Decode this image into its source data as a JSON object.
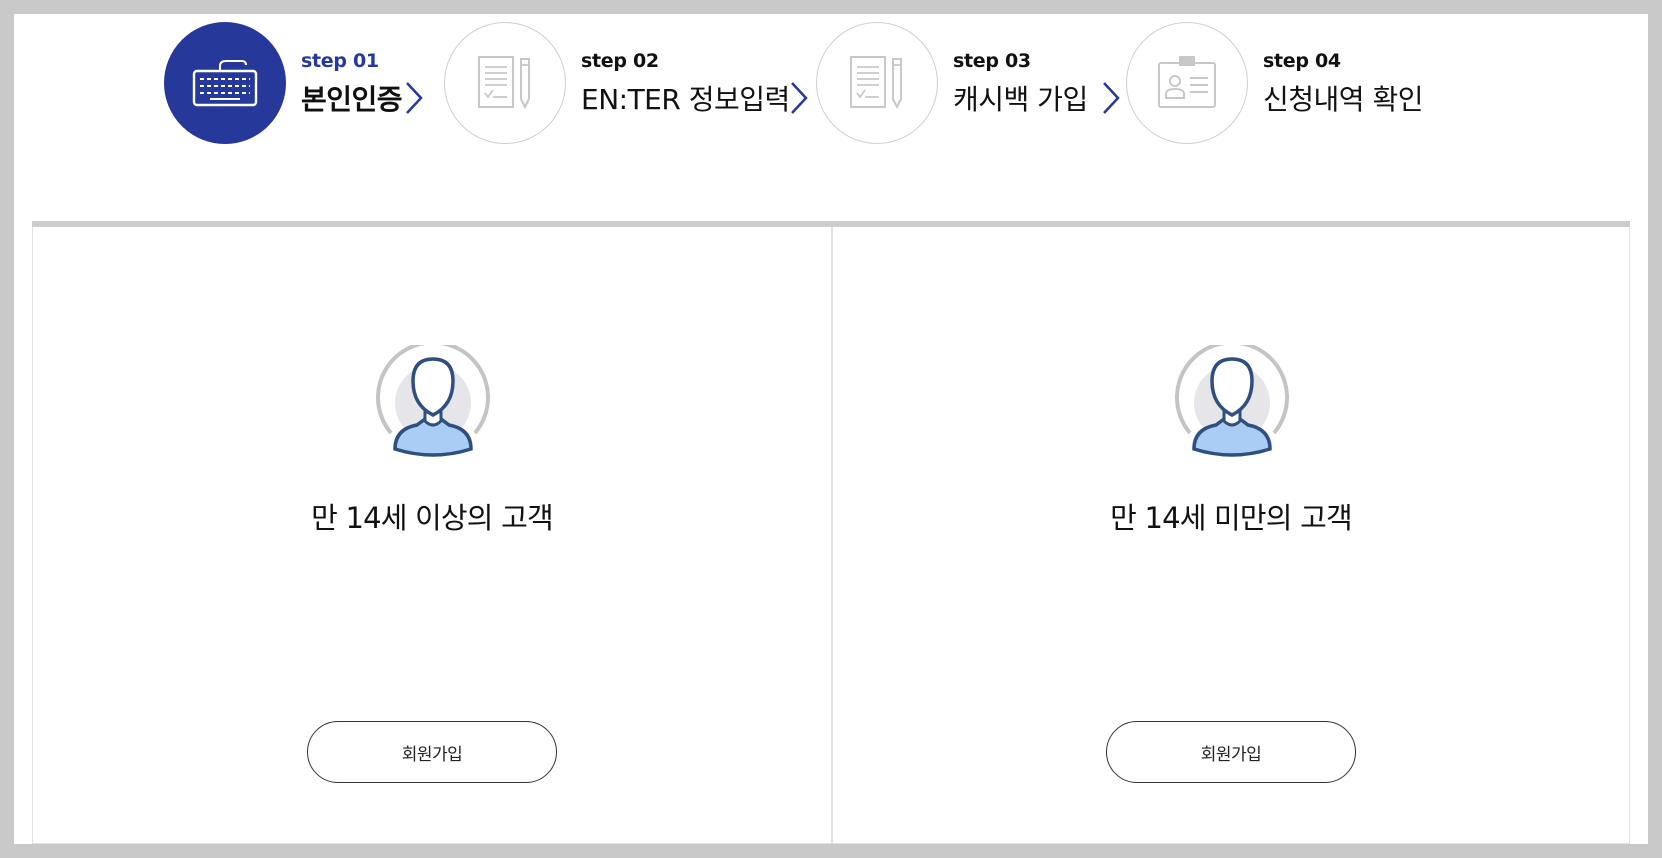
{
  "steps": [
    {
      "num": "step 01",
      "title": "본인인증",
      "icon": "keyboard-icon",
      "active": true
    },
    {
      "num": "step 02",
      "title": "EN:TER 정보입력",
      "icon": "document-pencil-icon",
      "active": false
    },
    {
      "num": "step 03",
      "title": "캐시백 가입",
      "icon": "document-pencil-icon",
      "active": false
    },
    {
      "num": "step 04",
      "title": "신청내역 확인",
      "icon": "id-card-icon",
      "active": false
    }
  ],
  "colors": {
    "accent": "#26399b",
    "inactive_icon": "#cfcfcf",
    "avatar_fill": "#a9cdf5",
    "avatar_stroke": "#2f4f7f"
  },
  "options": [
    {
      "label": "만 14세 이상의 고객",
      "button": "회원가입",
      "icon": "user-avatar-icon"
    },
    {
      "label": "만 14세 미만의 고객",
      "button": "회원가입",
      "icon": "user-avatar-icon"
    }
  ]
}
